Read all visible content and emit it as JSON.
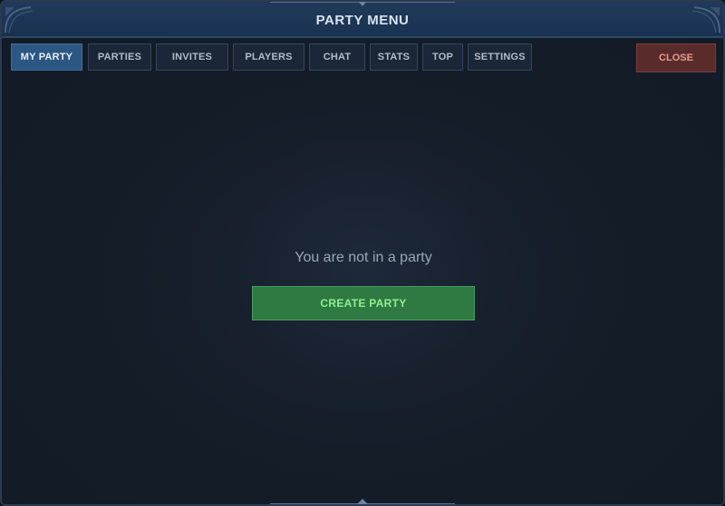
{
  "window": {
    "title": "PARTY MENU"
  },
  "tabs": [
    {
      "label": "MY PARTY",
      "active": true
    },
    {
      "label": "PARTIES",
      "active": false
    },
    {
      "label": "INVITES",
      "active": false
    },
    {
      "label": "PLAYERS",
      "active": false
    },
    {
      "label": "CHAT",
      "active": false
    },
    {
      "label": "STATS",
      "active": false
    },
    {
      "label": "TOP",
      "active": false
    },
    {
      "label": "SETTINGS",
      "active": false
    }
  ],
  "close_label": "CLOSE",
  "main": {
    "empty_message": "You are not in a party",
    "create_button_label": "CREATE PARTY"
  },
  "colors": {
    "accent_tab_active": "#2c5783",
    "close_bg": "#5a2b2b",
    "create_bg": "#2f7a42",
    "titlebar_bg": "#1f3a5a"
  }
}
